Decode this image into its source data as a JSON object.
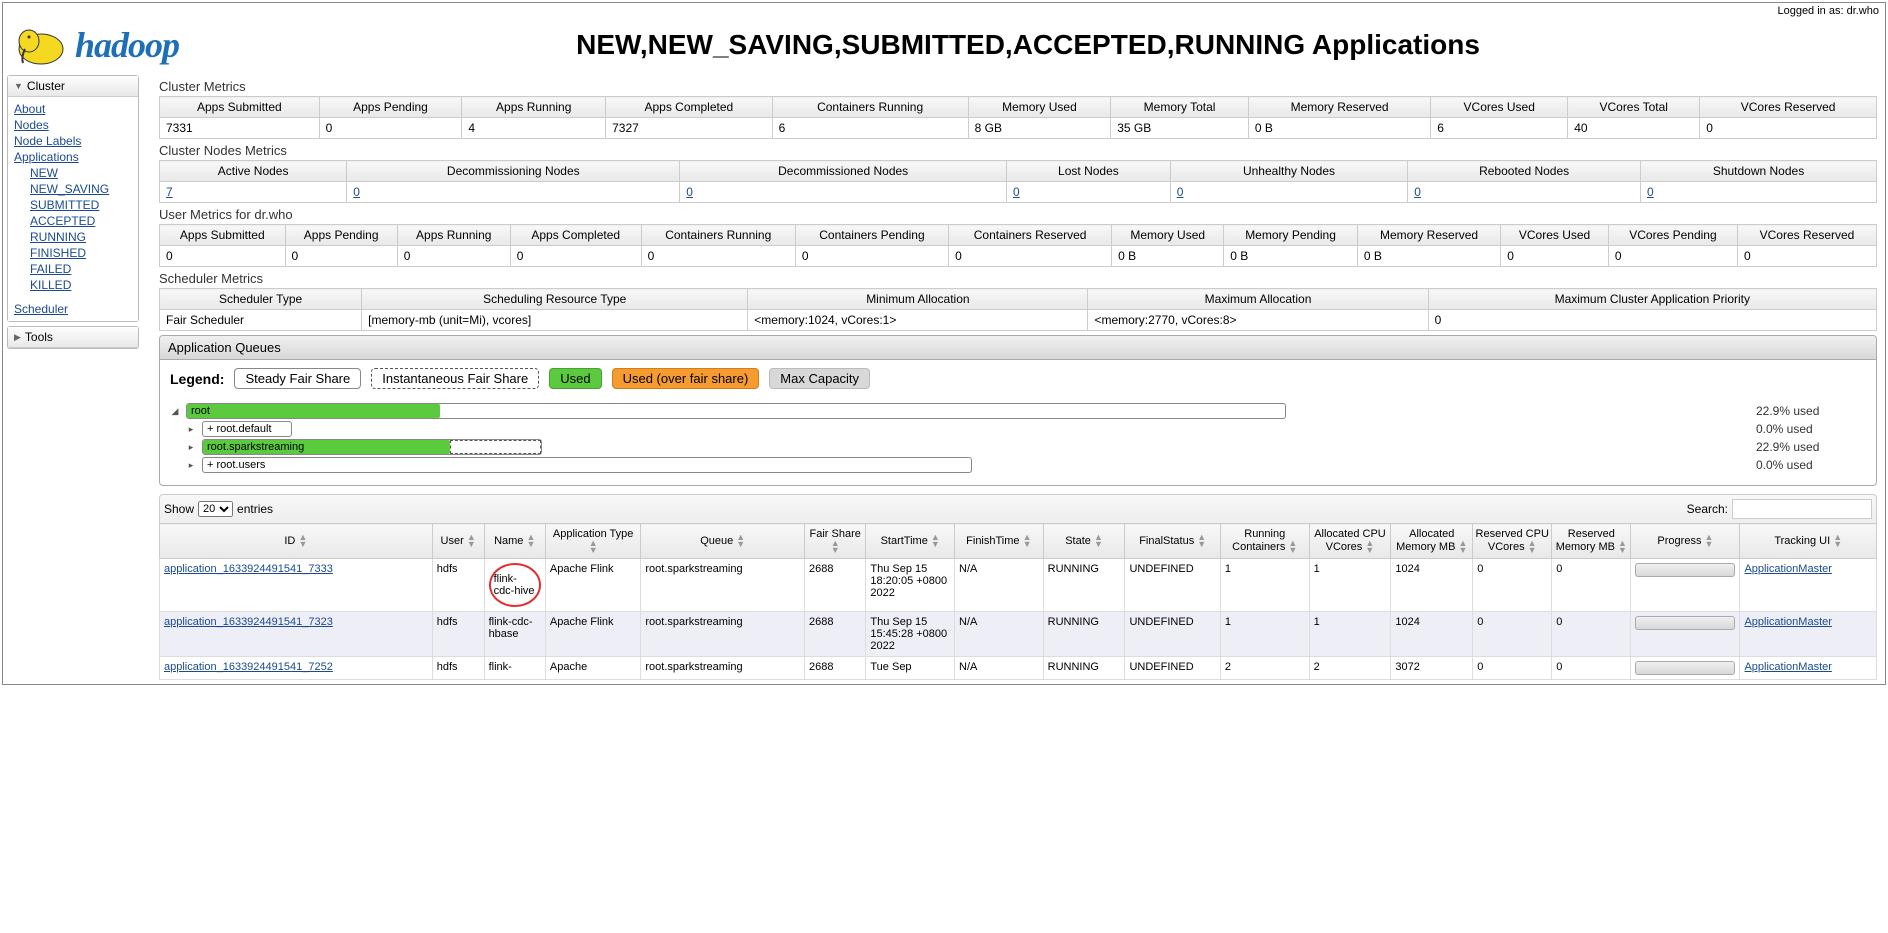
{
  "login": "Logged in as: dr.who",
  "logo_text": "hadoop",
  "page_title": "NEW,NEW_SAVING,SUBMITTED,ACCEPTED,RUNNING Applications",
  "sidebar": {
    "cluster_header": "Cluster",
    "tools_header": "Tools",
    "about": "About",
    "nodes": "Nodes",
    "node_labels": "Node Labels",
    "applications": "Applications",
    "new": "NEW",
    "new_saving": "NEW_SAVING",
    "submitted": "SUBMITTED",
    "accepted": "ACCEPTED",
    "running": "RUNNING",
    "finished": "FINISHED",
    "failed": "FAILED",
    "killed": "KILLED",
    "scheduler": "Scheduler"
  },
  "sections": {
    "cluster_metrics": "Cluster Metrics",
    "cluster_nodes": "Cluster Nodes Metrics",
    "user_metrics": "User Metrics for dr.who",
    "scheduler_metrics": "Scheduler Metrics",
    "app_queues": "Application Queues"
  },
  "cluster_metrics": {
    "headers": [
      "Apps Submitted",
      "Apps Pending",
      "Apps Running",
      "Apps Completed",
      "Containers Running",
      "Memory Used",
      "Memory Total",
      "Memory Reserved",
      "VCores Used",
      "VCores Total",
      "VCores Reserved"
    ],
    "values": [
      "7331",
      "0",
      "4",
      "7327",
      "6",
      "8 GB",
      "35 GB",
      "0 B",
      "6",
      "40",
      "0"
    ]
  },
  "nodes_metrics": {
    "headers": [
      "Active Nodes",
      "Decommissioning Nodes",
      "Decommissioned Nodes",
      "Lost Nodes",
      "Unhealthy Nodes",
      "Rebooted Nodes",
      "Shutdown Nodes"
    ],
    "values": [
      "7",
      "0",
      "0",
      "0",
      "0",
      "0",
      "0"
    ]
  },
  "user_metrics": {
    "headers": [
      "Apps Submitted",
      "Apps Pending",
      "Apps Running",
      "Apps Completed",
      "Containers Running",
      "Containers Pending",
      "Containers Reserved",
      "Memory Used",
      "Memory Pending",
      "Memory Reserved",
      "VCores Used",
      "VCores Pending",
      "VCores Reserved"
    ],
    "values": [
      "0",
      "0",
      "0",
      "0",
      "0",
      "0",
      "0",
      "0 B",
      "0 B",
      "0 B",
      "0",
      "0",
      "0"
    ]
  },
  "sched_metrics": {
    "headers": [
      "Scheduler Type",
      "Scheduling Resource Type",
      "Minimum Allocation",
      "Maximum Allocation",
      "Maximum Cluster Application Priority"
    ],
    "values": [
      "Fair Scheduler",
      "[memory-mb (unit=Mi), vcores]",
      "<memory:1024, vCores:1>",
      "<memory:2770, vCores:8>",
      "0"
    ]
  },
  "legend": {
    "label": "Legend:",
    "steady": "Steady Fair Share",
    "instant": "Instantaneous Fair Share",
    "used": "Used",
    "over": "Used (over fair share)",
    "max": "Max Capacity"
  },
  "queues": {
    "root": {
      "name": "root",
      "used": "22.9% used"
    },
    "default": {
      "name": "+ root.default",
      "used": "0.0% used"
    },
    "spark": {
      "name": "root.sparkstreaming",
      "used": "22.9% used"
    },
    "users": {
      "name": "+ root.users",
      "used": "0.0% used"
    }
  },
  "show_label": "Show",
  "show_value": "20",
  "entries_label": "entries",
  "search_label": "Search:",
  "app_headers": [
    "ID",
    "User",
    "Name",
    "Application Type",
    "Queue",
    "Fair Share",
    "StartTime",
    "FinishTime",
    "State",
    "FinalStatus",
    "Running Containers",
    "Allocated CPU VCores",
    "Allocated Memory MB",
    "Reserved CPU VCores",
    "Reserved Memory MB",
    "Progress",
    "Tracking UI"
  ],
  "apps": [
    {
      "id": "application_1633924491541_7333",
      "user": "hdfs",
      "name": "flink-cdc-hive",
      "type": "Apache Flink",
      "queue": "root.sparkstreaming",
      "fair": "2688",
      "start": "Thu Sep 15 18:20:05 +0800 2022",
      "finish": "N/A",
      "state": "RUNNING",
      "final": "UNDEFINED",
      "rc": "1",
      "cpu": "1",
      "mem": "1024",
      "rcpu": "0",
      "rmem": "0",
      "track": "ApplicationMaster",
      "highlight": true
    },
    {
      "id": "application_1633924491541_7323",
      "user": "hdfs",
      "name": "flink-cdc-hbase",
      "type": "Apache Flink",
      "queue": "root.sparkstreaming",
      "fair": "2688",
      "start": "Thu Sep 15 15:45:28 +0800 2022",
      "finish": "N/A",
      "state": "RUNNING",
      "final": "UNDEFINED",
      "rc": "1",
      "cpu": "1",
      "mem": "1024",
      "rcpu": "0",
      "rmem": "0",
      "track": "ApplicationMaster"
    },
    {
      "id": "application_1633924491541_7252",
      "user": "hdfs",
      "name": "flink-",
      "type": "Apache",
      "queue": "root.sparkstreaming",
      "fair": "2688",
      "start": "Tue Sep",
      "finish": "N/A",
      "state": "RUNNING",
      "final": "UNDEFINED",
      "rc": "2",
      "cpu": "2",
      "mem": "3072",
      "rcpu": "0",
      "rmem": "0",
      "track": "ApplicationMaster"
    }
  ]
}
